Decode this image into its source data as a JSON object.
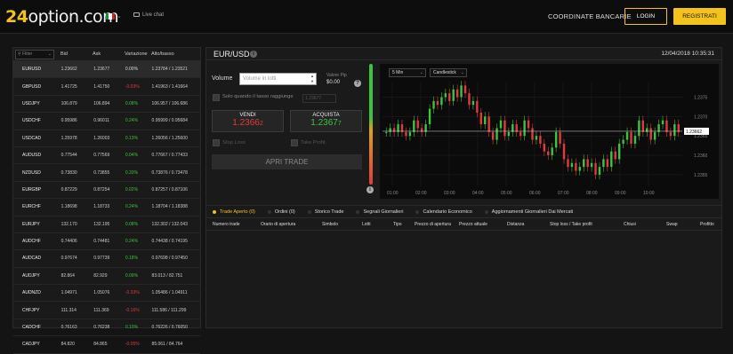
{
  "header": {
    "logo_num": "24",
    "logo_text": "option.com",
    "flag_colors": [
      "#1a8f3a",
      "#ffffff",
      "#d0202a"
    ],
    "live_chat": "Live chat",
    "coordinate": "COORDINATE BANCARIE",
    "login": "LOGIN",
    "register": "REGISTRATI"
  },
  "watchlist": {
    "filter_placeholder": "Filter",
    "columns": [
      "Bid",
      "Ask",
      "Variazione",
      "Alto/basso"
    ],
    "rows": [
      {
        "symbol": "EURUSD",
        "bid": "1.23662",
        "ask": "1.23677",
        "change": "0.00%",
        "dir": "zer",
        "highlow": "1.23784 / 1.23521"
      },
      {
        "symbol": "GBPUSD",
        "bid": "1.41725",
        "ask": "1.41750",
        "change": "-0.03%",
        "dir": "neg",
        "highlow": "1.41963 / 1.41664"
      },
      {
        "symbol": "USDJPY",
        "bid": "106.879",
        "ask": "106.894",
        "change": "0.08%",
        "dir": "pos",
        "highlow": "106.957 / 106.686"
      },
      {
        "symbol": "USDCHF",
        "bid": "0.95986",
        "ask": "0.96011",
        "change": "0.24%",
        "dir": "pos",
        "highlow": "0.95999 / 0.95684"
      },
      {
        "symbol": "USDCAD",
        "bid": "1.25978",
        "ask": "1.26003",
        "change": "0.13%",
        "dir": "pos",
        "highlow": "1.26056 / 1.25600"
      },
      {
        "symbol": "AUDUSD",
        "bid": "0.77544",
        "ask": "0.77569",
        "change": "0.04%",
        "dir": "pos",
        "highlow": "0.77667 / 0.77433"
      },
      {
        "symbol": "NZDUSD",
        "bid": "0.73830",
        "ask": "0.73855",
        "change": "0.33%",
        "dir": "pos",
        "highlow": "0.73876 / 0.73478"
      },
      {
        "symbol": "EURGBP",
        "bid": "0.87229",
        "ask": "0.87254",
        "change": "0.02%",
        "dir": "pos",
        "highlow": "0.87257 / 0.87106"
      },
      {
        "symbol": "EURCHF",
        "bid": "1.18698",
        "ask": "1.18733",
        "change": "0.24%",
        "dir": "pos",
        "highlow": "1.18704 / 1.18388"
      },
      {
        "symbol": "EURJPY",
        "bid": "132.170",
        "ask": "132.195",
        "change": "0.08%",
        "dir": "pos",
        "highlow": "132.302 / 132.043"
      },
      {
        "symbol": "AUDCHF",
        "bid": "0.74406",
        "ask": "0.74481",
        "change": "0.24%",
        "dir": "pos",
        "highlow": "0.74438 / 0.74195"
      },
      {
        "symbol": "AUDCAD",
        "bid": "0.97674",
        "ask": "0.97739",
        "change": "0.18%",
        "dir": "pos",
        "highlow": "0.97698 / 0.97450"
      },
      {
        "symbol": "AUDJPY",
        "bid": "82.864",
        "ask": "82.929",
        "change": "0.09%",
        "dir": "pos",
        "highlow": "83.013 / 82.751"
      },
      {
        "symbol": "AUDNZD",
        "bid": "1.04971",
        "ask": "1.05076",
        "change": "-0.33%",
        "dir": "neg",
        "highlow": "1.05486 / 1.04911"
      },
      {
        "symbol": "CHFJPY",
        "bid": "111.314",
        "ask": "111.369",
        "change": "-0.16%",
        "dir": "neg",
        "highlow": "111.586 / 111.299"
      },
      {
        "symbol": "CADCHF",
        "bid": "0.76163",
        "ask": "0.76238",
        "change": "0.10%",
        "dir": "pos",
        "highlow": "0.76226 / 0.76050"
      },
      {
        "symbol": "CADJPY",
        "bid": "84.820",
        "ask": "84.865",
        "change": "-0.05%",
        "dir": "neg",
        "highlow": "85.061 / 84.764"
      }
    ]
  },
  "trade": {
    "pair": "EUR/USD",
    "datetime": "12/04/2018 10:35:31",
    "volume_label": "Volume",
    "volume_placeholder": "Volume in lotti",
    "pip_label": "Valore Pip",
    "pip_value": "$0.00",
    "only_when_label": "Solo quando il tasso raggiunge",
    "only_when_value": "1.23677",
    "sell_label": "VENDI",
    "sell_price_main": "1.2366",
    "sell_price_sub": "2",
    "buy_label": "ACQUISTA",
    "buy_price_main": "1.2367",
    "buy_price_sub": "7",
    "stop_loss": "Stop Loss",
    "take_profit": "Take Profit",
    "open_trade": "APRI TRADE"
  },
  "chart_controls": {
    "interval": "5 Min",
    "chart_type": "Candlestick"
  },
  "chart_data": {
    "type": "candlestick",
    "x_ticks": [
      "01:00",
      "02:00",
      "03:00",
      "04:00",
      "05:00",
      "06:00",
      "07:00",
      "08:00",
      "09:00",
      "10:00"
    ],
    "y_ticks": [
      1.2375,
      1.237,
      1.2365,
      1.236,
      1.2355
    ],
    "ylim": [
      1.2352,
      1.2379
    ],
    "current_price_label": "1.23662",
    "current_price": 1.23662,
    "close_series": [
      1.2366,
      1.2367,
      1.2366,
      1.2368,
      1.2366,
      1.2365,
      1.2366,
      1.2369,
      1.2367,
      1.2366,
      1.2368,
      1.2372,
      1.2374,
      1.2373,
      1.2375,
      1.2376,
      1.2374,
      1.2377,
      1.2375,
      1.2378,
      1.2376,
      1.2373,
      1.2374,
      1.2371,
      1.2368,
      1.237,
      1.2366,
      1.2364,
      1.2367,
      1.2369,
      1.2365,
      1.2366,
      1.2368,
      1.2366,
      1.2365,
      1.2369,
      1.2367,
      1.2364,
      1.2365,
      1.2363,
      1.2361,
      1.236,
      1.2362,
      1.2366,
      1.2363,
      1.2359,
      1.2357,
      1.2358,
      1.2356,
      1.2357,
      1.2359,
      1.2357,
      1.2358,
      1.2355,
      1.2357,
      1.2359,
      1.2357,
      1.2361,
      1.2359,
      1.2363,
      1.2364,
      1.2366,
      1.2363,
      1.2365,
      1.2369,
      1.2366,
      1.2367,
      1.2364,
      1.2366,
      1.2368,
      1.2369,
      1.2366,
      1.2365,
      1.2368,
      1.2366
    ]
  },
  "tabs": [
    {
      "label": "Trade Aperto (0)",
      "active": true
    },
    {
      "label": "Ordini (0)",
      "active": false
    },
    {
      "label": "Storico Trade",
      "active": false
    },
    {
      "label": "Segnali Giornalieri",
      "active": false
    },
    {
      "label": "Calendario Economico",
      "active": false
    },
    {
      "label": "Aggiornamenti Giornalieri Dai Mercati",
      "active": false
    }
  ],
  "table_columns": [
    "Numero trade",
    "Orario di apertura",
    "Simbolo",
    "Lotti",
    "Tipo",
    "Prezzo di apertura",
    "Prezzo attuale",
    "Distanza",
    "Stop loss / Take profit",
    "Chiusi",
    "Swap",
    "Profitto"
  ]
}
